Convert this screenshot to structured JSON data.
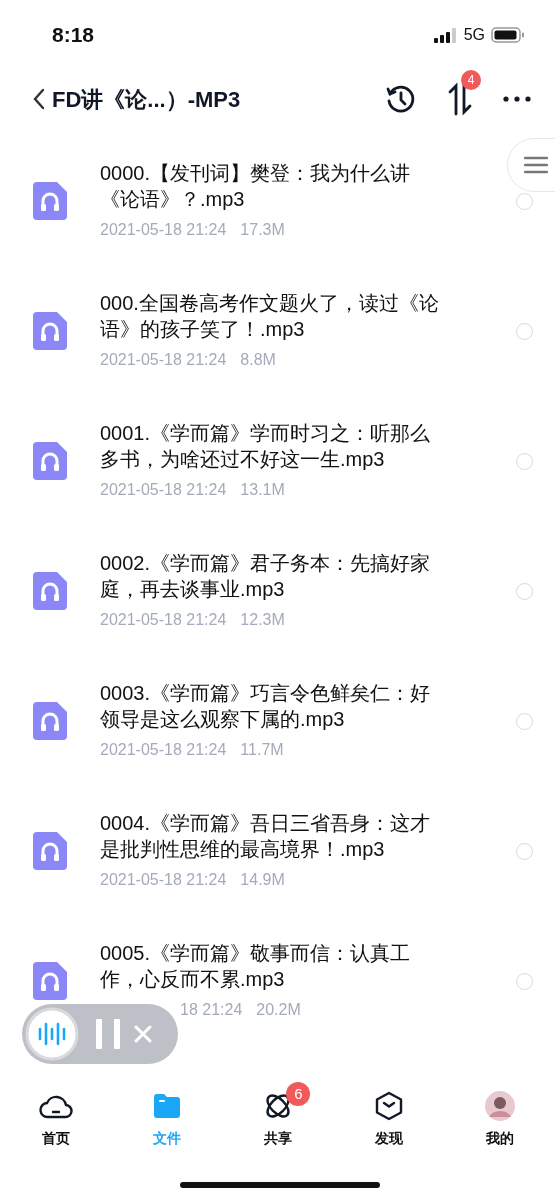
{
  "status_bar": {
    "time": "8:18",
    "network": "5G"
  },
  "header": {
    "title": "FD讲《论...）-MP3",
    "transfer_badge": "4"
  },
  "files": [
    {
      "name": "0000.【发刊词】樊登：我为什么讲《论语》？.mp3",
      "date": "2021-05-18 21:24",
      "size": "17.3M",
      "selected": false
    },
    {
      "name": "000.全国卷高考作文题火了，读过《论语》的孩子笑了！.mp3",
      "date": "2021-05-18 21:24",
      "size": "8.8M",
      "selected": false
    },
    {
      "name": "0001.《学而篇》学而时习之：听那么多书，为啥还过不好这一生.mp3",
      "date": "2021-05-18 21:24",
      "size": "13.1M",
      "selected": false
    },
    {
      "name": "0002.《学而篇》君子务本：先搞好家庭，再去谈事业.mp3",
      "date": "2021-05-18 21:24",
      "size": "12.3M",
      "selected": false
    },
    {
      "name": "0003.《学而篇》巧言令色鲜矣仁：好领导是这么观察下属的.mp3",
      "date": "2021-05-18 21:24",
      "size": "11.7M",
      "selected": false
    },
    {
      "name": "0004.《学而篇》吾日三省吾身：这才是批判性思维的最高境界！.mp3",
      "date": "2021-05-18 21:24",
      "size": "14.9M",
      "selected": false
    },
    {
      "name": "0005.《学而篇》敬事而信：认真工作，心反而不累.mp3",
      "date": "18 21:24",
      "size": "20.2M",
      "selected": false
    }
  ],
  "tabs": [
    {
      "label": "首页",
      "kind": "home",
      "selected": false
    },
    {
      "label": "文件",
      "kind": "files",
      "selected": true
    },
    {
      "label": "共享",
      "kind": "share",
      "selected": false,
      "badge": "6"
    },
    {
      "label": "发现",
      "kind": "discover",
      "selected": false
    },
    {
      "label": "我的",
      "kind": "me",
      "selected": false
    }
  ]
}
